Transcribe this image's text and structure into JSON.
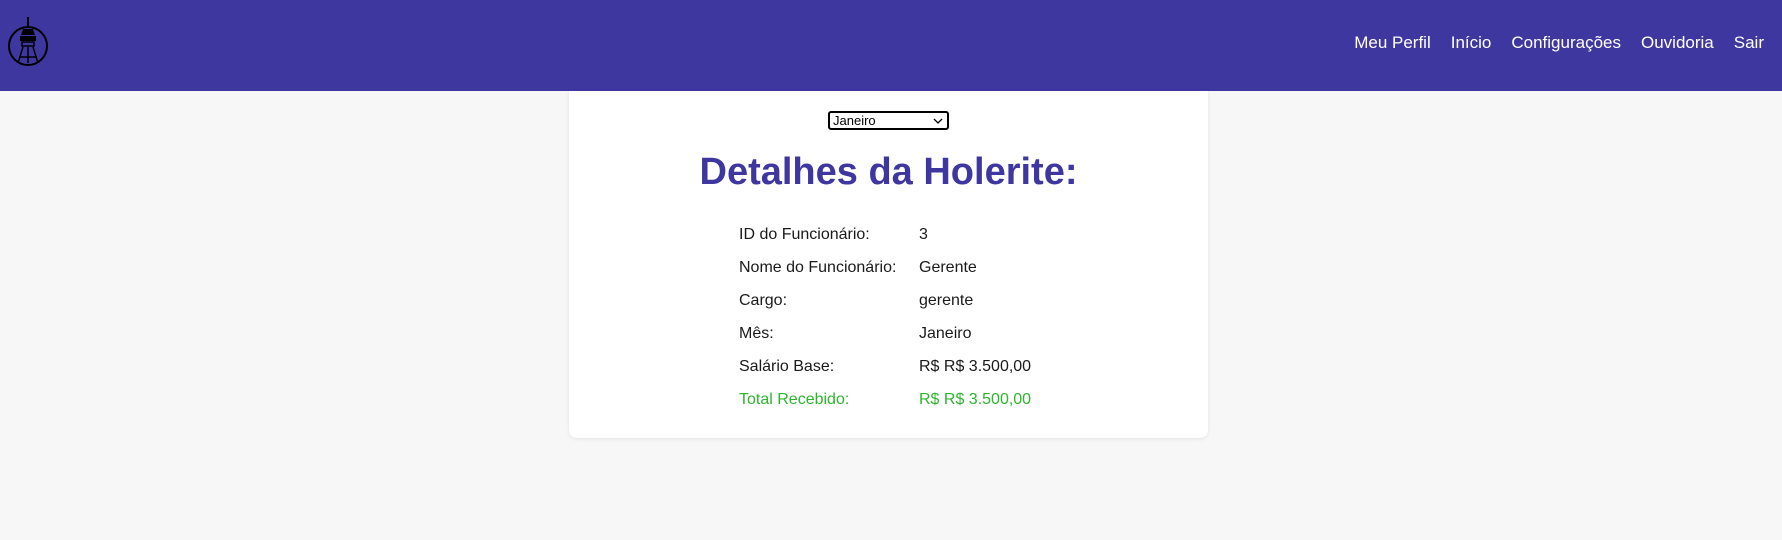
{
  "navbar": {
    "background_color": "#3f37a0",
    "logo_icon": "tower-icon",
    "links": [
      "Meu Perfil",
      "Início",
      "Configurações",
      "Ouvidoria",
      "Sair"
    ]
  },
  "month_select": {
    "selected": "Janeiro"
  },
  "title": "Detalhes da Holerite:",
  "details": [
    {
      "label": "ID do Funcionário:",
      "value": "3"
    },
    {
      "label": "Nome do Funcionário:",
      "value": "Gerente"
    },
    {
      "label": "Cargo:",
      "value": "gerente"
    },
    {
      "label": "Mês:",
      "value": "Janeiro"
    },
    {
      "label": "Salário Base:",
      "value": "R$ R$ 3.500,00"
    }
  ],
  "total": {
    "label": "Total Recebido:",
    "value": "R$ R$ 3.500,00",
    "color": "#2db52d"
  }
}
